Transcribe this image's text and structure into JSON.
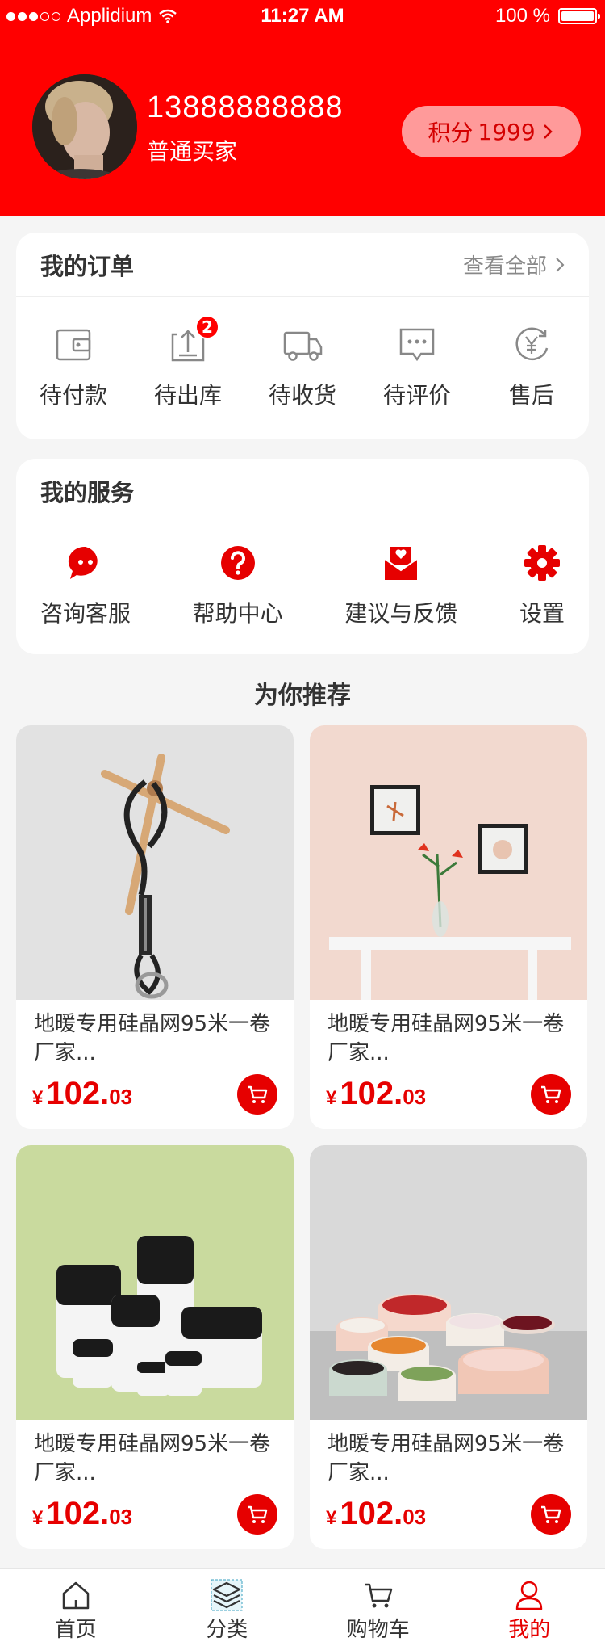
{
  "status_bar": {
    "carrier": "Applidium",
    "time": "11:27 AM",
    "battery": "100 %"
  },
  "profile": {
    "phone": "13888888888",
    "level": "普通买家",
    "points_label": "积分",
    "points_value": "1999"
  },
  "orders": {
    "title": "我的订单",
    "view_all": "查看全部",
    "items": [
      {
        "label": "待付款",
        "icon": "wallet-icon"
      },
      {
        "label": "待出库",
        "icon": "upload-box-icon",
        "badge": "2"
      },
      {
        "label": "待收货",
        "icon": "truck-icon"
      },
      {
        "label": "待评价",
        "icon": "comment-icon"
      },
      {
        "label": "售后",
        "icon": "yen-refresh-icon"
      }
    ]
  },
  "services": {
    "title": "我的服务",
    "items": [
      {
        "label": "咨询客服",
        "icon": "chat-bubble-icon"
      },
      {
        "label": "帮助中心",
        "icon": "question-icon"
      },
      {
        "label": "建议与反馈",
        "icon": "envelope-heart-icon"
      },
      {
        "label": "设置",
        "icon": "gear-icon"
      }
    ]
  },
  "recommend": {
    "title": "为你推荐",
    "products": [
      {
        "name": "地暖专用硅晶网95米一卷厂家...",
        "currency": "¥",
        "price_int": "102.",
        "price_dec": "03"
      },
      {
        "name": "地暖专用硅晶网95米一卷厂家...",
        "currency": "¥",
        "price_int": "102.",
        "price_dec": "03"
      },
      {
        "name": "地暖专用硅晶网95米一卷厂家...",
        "currency": "¥",
        "price_int": "102.",
        "price_dec": "03"
      },
      {
        "name": "地暖专用硅晶网95米一卷厂家...",
        "currency": "¥",
        "price_int": "102.",
        "price_dec": "03"
      }
    ]
  },
  "tabbar": {
    "items": [
      {
        "label": "首页",
        "icon": "home-icon"
      },
      {
        "label": "分类",
        "icon": "layers-icon"
      },
      {
        "label": "购物车",
        "icon": "cart-icon"
      },
      {
        "label": "我的",
        "icon": "user-icon",
        "active": true
      }
    ]
  },
  "colors": {
    "primary": "#ff0000",
    "accent": "#e60000",
    "points_bg": "#ff9a9a",
    "background": "#f5f5f5"
  }
}
